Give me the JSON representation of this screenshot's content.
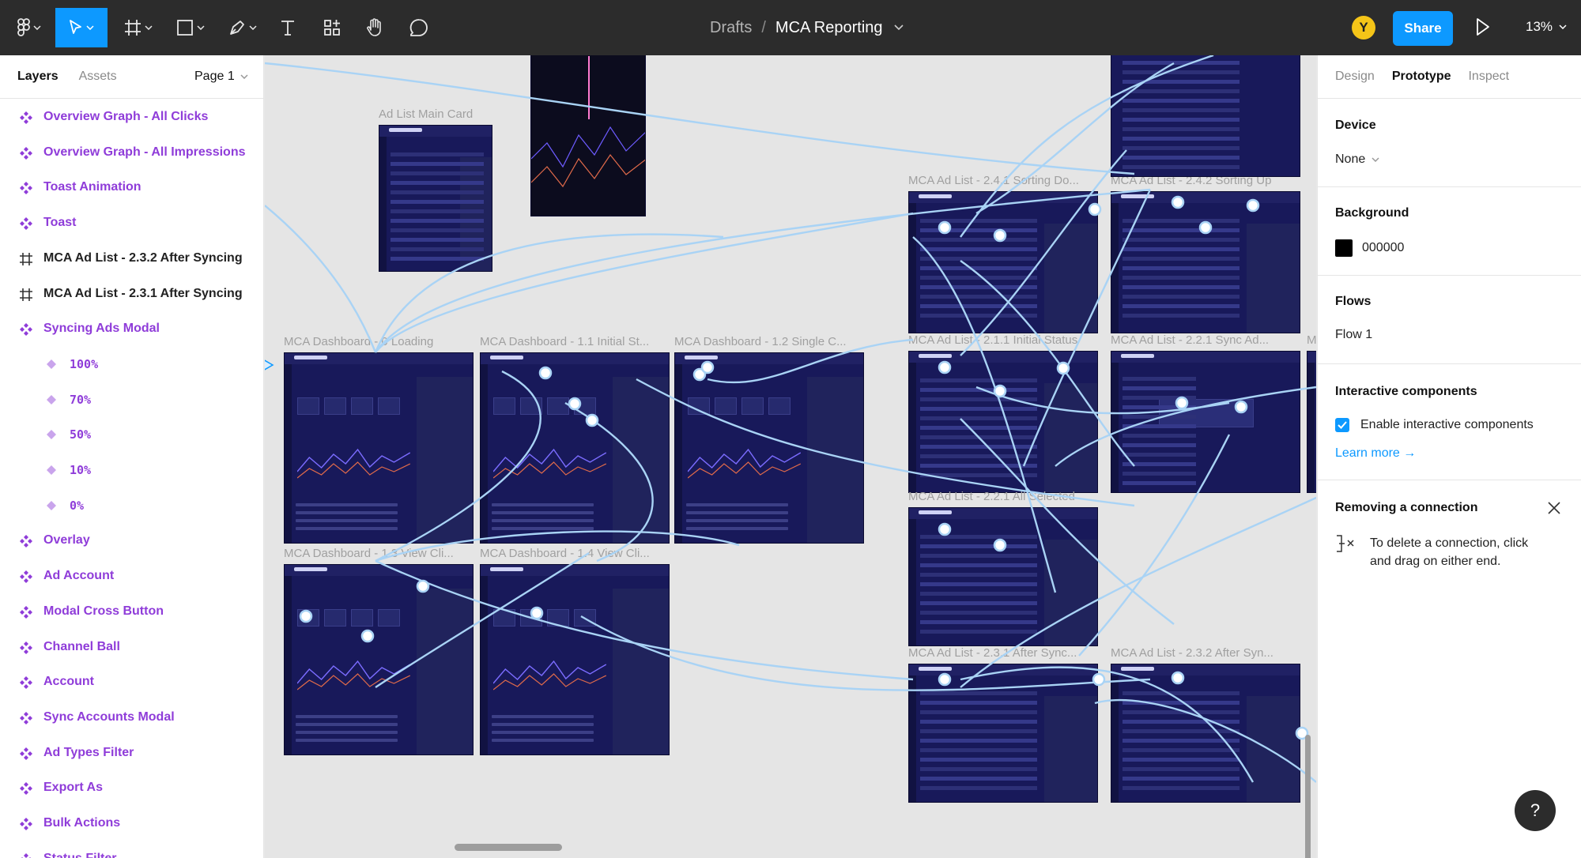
{
  "toolbar": {
    "breadcrumb_project": "Drafts",
    "breadcrumb_sep": "/",
    "file_name": "MCA Reporting",
    "avatar_initial": "Y",
    "share_label": "Share",
    "zoom_level": "13%",
    "accent_color": "#0d99ff"
  },
  "left_panel": {
    "tabs": [
      "Layers",
      "Assets"
    ],
    "page_label": "Page 1",
    "layers": [
      {
        "label": "Overview Graph - All Clicks",
        "kind": "component",
        "icon": "component-icon"
      },
      {
        "label": "Overview Graph - All Impressions",
        "kind": "component",
        "icon": "component-icon"
      },
      {
        "label": "Toast Animation",
        "kind": "component",
        "icon": "component-icon"
      },
      {
        "label": "Toast",
        "kind": "component",
        "icon": "component-icon"
      },
      {
        "label": "MCA Ad List - 2.3.2 After Syncing",
        "kind": "frame",
        "icon": "frame-icon"
      },
      {
        "label": "MCA Ad List - 2.3.1 After Syncing",
        "kind": "frame",
        "icon": "frame-icon"
      },
      {
        "label": "Syncing Ads Modal",
        "kind": "component",
        "icon": "component-icon"
      },
      {
        "label": "100%",
        "kind": "variant",
        "icon": "variant-icon"
      },
      {
        "label": "70%",
        "kind": "variant",
        "icon": "variant-icon"
      },
      {
        "label": "50%",
        "kind": "variant",
        "icon": "variant-icon"
      },
      {
        "label": "10%",
        "kind": "variant",
        "icon": "variant-icon"
      },
      {
        "label": "0%",
        "kind": "variant",
        "icon": "variant-icon"
      },
      {
        "label": "Overlay",
        "kind": "component",
        "icon": "component-icon"
      },
      {
        "label": "Ad Account",
        "kind": "component",
        "icon": "component-icon"
      },
      {
        "label": "Modal Cross Button",
        "kind": "component",
        "icon": "component-icon"
      },
      {
        "label": "Channel Ball",
        "kind": "component",
        "icon": "component-icon"
      },
      {
        "label": "Account",
        "kind": "component",
        "icon": "component-icon"
      },
      {
        "label": "Sync Accounts Modal",
        "kind": "component",
        "icon": "component-icon"
      },
      {
        "label": "Ad Types Filter",
        "kind": "component",
        "icon": "component-icon"
      },
      {
        "label": "Export As",
        "kind": "component",
        "icon": "component-icon"
      },
      {
        "label": "Bulk Actions",
        "kind": "component",
        "icon": "component-icon"
      },
      {
        "label": "Status Filter",
        "kind": "component",
        "icon": "component-icon"
      }
    ]
  },
  "canvas": {
    "frames": [
      {
        "label": "Ad List Main Card",
        "kind": "list"
      },
      {
        "label": "MCA Dashboard - 0 Loading",
        "kind": "dash"
      },
      {
        "label": "MCA Dashboard - 1.1 Initial St...",
        "kind": "dash"
      },
      {
        "label": "MCA Dashboard - 1.2 Single C...",
        "kind": "dash"
      },
      {
        "label": "MCA Dashboard - 1.3 View Cli...",
        "kind": "dash"
      },
      {
        "label": "MCA Dashboard - 1.4 View Cli...",
        "kind": "dash"
      },
      {
        "label": "MCA Ad List - 2.4.1 Sorting Do...",
        "kind": "list"
      },
      {
        "label": "MCA Ad List - 2.4.2 Sorting Up",
        "kind": "list"
      },
      {
        "label": "MCA Ad List - 2.1.1 Initial Status",
        "kind": "list"
      },
      {
        "label": "MCA Ad List - 2.2.1 Sync Ad...",
        "kind": "modal"
      },
      {
        "label": "MCA Ad List - 2.2.1 All Selected",
        "kind": "list"
      },
      {
        "label": "MCA Ad List - 2.3.1 After Sync...",
        "kind": "list"
      },
      {
        "label": "MCA Ad List - 2.3.2 After Syn...",
        "kind": "list"
      },
      {
        "label": "M",
        "kind": "list"
      }
    ],
    "frame_app_title": "Ads Manager",
    "overview_label": "Overview",
    "frame_color": "#18195a",
    "connection_color": "#a9d3f5"
  },
  "right_panel": {
    "tabs": [
      "Design",
      "Prototype",
      "Inspect"
    ],
    "active_tab": "Prototype",
    "device_title": "Device",
    "device_value": "None",
    "background_title": "Background",
    "background_value": "000000",
    "flows_title": "Flows",
    "flow_name": "Flow 1",
    "interactive_title": "Interactive components",
    "interactive_checkbox": "Enable interactive components",
    "learn_more": "Learn more →",
    "removing_title": "Removing a connection",
    "removing_text_1": "To delete a connection, click",
    "removing_text_2": "and drag on either end."
  },
  "help_label": "?"
}
